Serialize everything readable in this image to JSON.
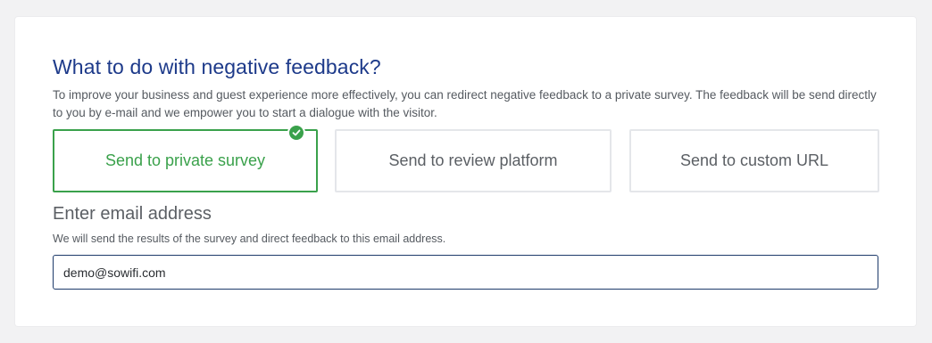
{
  "section": {
    "title": "What to do with negative feedback?",
    "description": "To improve your business and guest experience more effectively, you can redirect negative feedback to a private survey. The feedback will be send directly to you by e-mail and we empower you to start a dialogue with the visitor."
  },
  "options": [
    {
      "label": "Send to private survey",
      "selected": true
    },
    {
      "label": "Send to review platform",
      "selected": false
    },
    {
      "label": "Send to custom URL",
      "selected": false
    }
  ],
  "email": {
    "title": "Enter email address",
    "hint": "We will send the results of the survey and direct feedback to this email address.",
    "value": "demo@sowifi.com"
  },
  "colors": {
    "title": "#1d3a8a",
    "selected": "#3aa14b",
    "text": "#5b5f64",
    "input_border": "#1d3a6a"
  },
  "icons": {
    "selected_marker": "check-circle-icon"
  }
}
